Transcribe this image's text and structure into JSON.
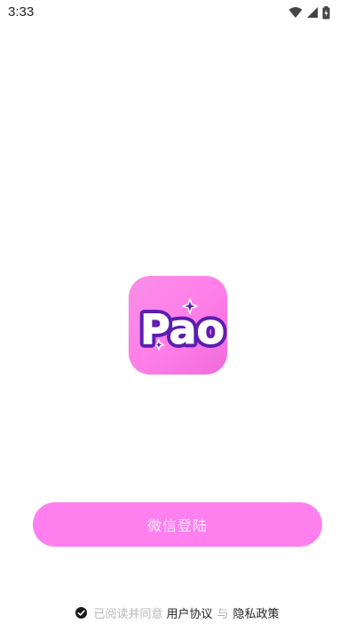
{
  "status_bar": {
    "time": "3:33",
    "icons": [
      "wifi-icon",
      "signal-icon",
      "battery-icon"
    ]
  },
  "logo": {
    "text": "Pao",
    "icon": "app-logo-icon",
    "colors": {
      "background": "#ff7fe8",
      "text": "#ffffff",
      "outline": "#5a1fb0"
    }
  },
  "login": {
    "button_label": "微信登陆",
    "color": "#ff7fef"
  },
  "agreement": {
    "prefix": "已阅读并同意",
    "user_agreement": "用户协议",
    "separator": "与",
    "privacy_policy": "隐私政策",
    "checked": true
  }
}
